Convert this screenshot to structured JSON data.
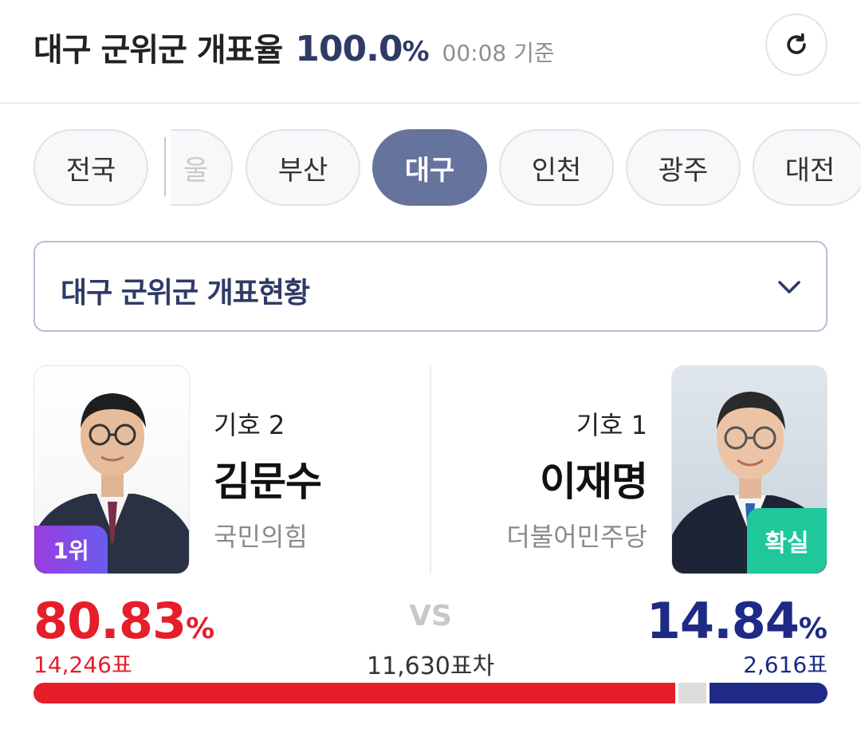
{
  "header": {
    "title": "대구 군위군 개표율",
    "count_rate": "100.0",
    "percent_sign": "%",
    "time": "00:08 기준",
    "refresh_icon": "refresh-icon"
  },
  "tabs": [
    {
      "label": "전국",
      "active": false
    },
    {
      "label": "울",
      "active": false
    },
    {
      "label": "부산",
      "active": false
    },
    {
      "label": "대구",
      "active": true
    },
    {
      "label": "인천",
      "active": false
    },
    {
      "label": "광주",
      "active": false
    },
    {
      "label": "대전",
      "active": false
    }
  ],
  "dropdown": {
    "label": "대구 군위군 개표현황",
    "icon": "chevron-down-icon"
  },
  "candidates": {
    "left": {
      "number": "기호 2",
      "name": "김문수",
      "party": "국민의힘",
      "badge": "1위",
      "percent": "80.83",
      "percent_sign": "%",
      "votes": "14,246표",
      "share": 80.83
    },
    "right": {
      "number": "기호 1",
      "name": "이재명",
      "party": "더불어민주당",
      "badge": "확실",
      "percent": "14.84",
      "percent_sign": "%",
      "votes": "2,616표",
      "share": 14.84
    }
  },
  "comparison": {
    "vs": "VS",
    "difference": "11,630표차"
  },
  "colors": {
    "left_accent": "#e51e2a",
    "right_accent": "#1e2a86",
    "active_tab": "#66739c",
    "confirm_badge": "#1fc79a"
  }
}
